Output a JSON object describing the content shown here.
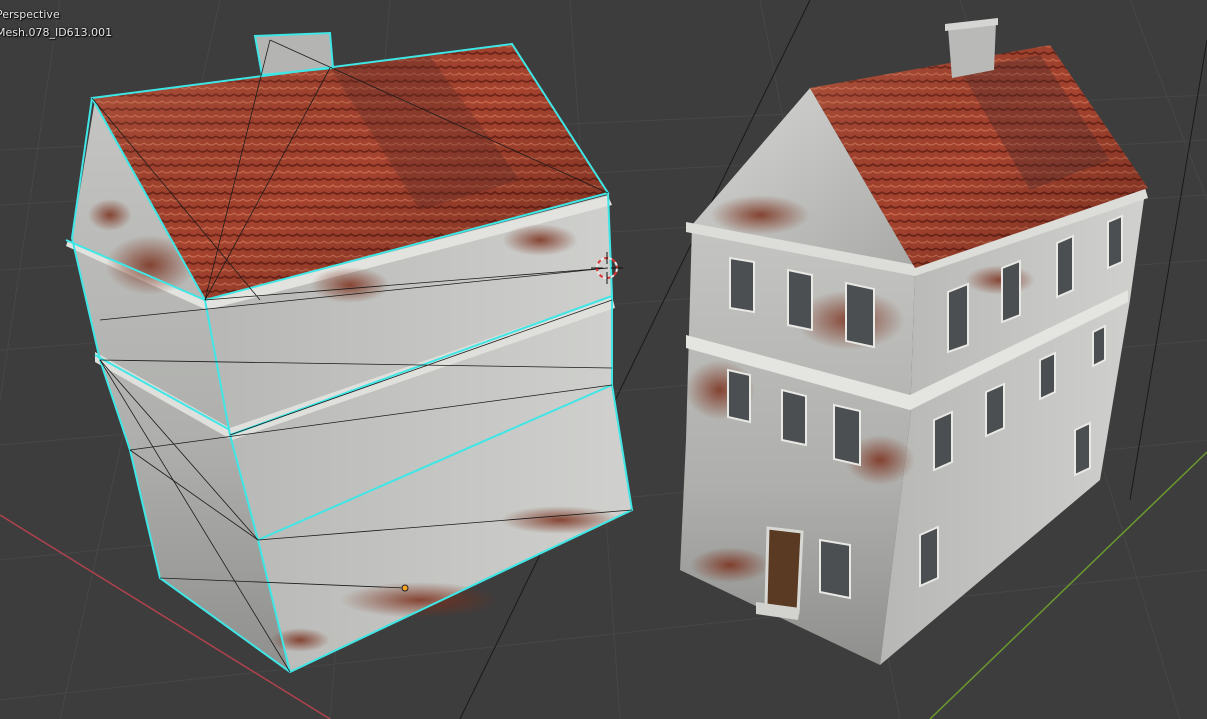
{
  "viewport": {
    "view_mode": "Perspective",
    "active_object": "Mesh.078_ID613.001"
  },
  "colors": {
    "background": "#3d3d3d",
    "grid_line": "#474747",
    "x_axis": "#b0424e",
    "y_axis": "#6a9a2e",
    "selection_outline": "#3fe6e6",
    "roof": "#a84a34",
    "wall": "#b9bab6",
    "rust": "#7a2e1a"
  },
  "icons": {
    "cursor": "3d-cursor-icon",
    "origin": "object-origin-icon"
  }
}
